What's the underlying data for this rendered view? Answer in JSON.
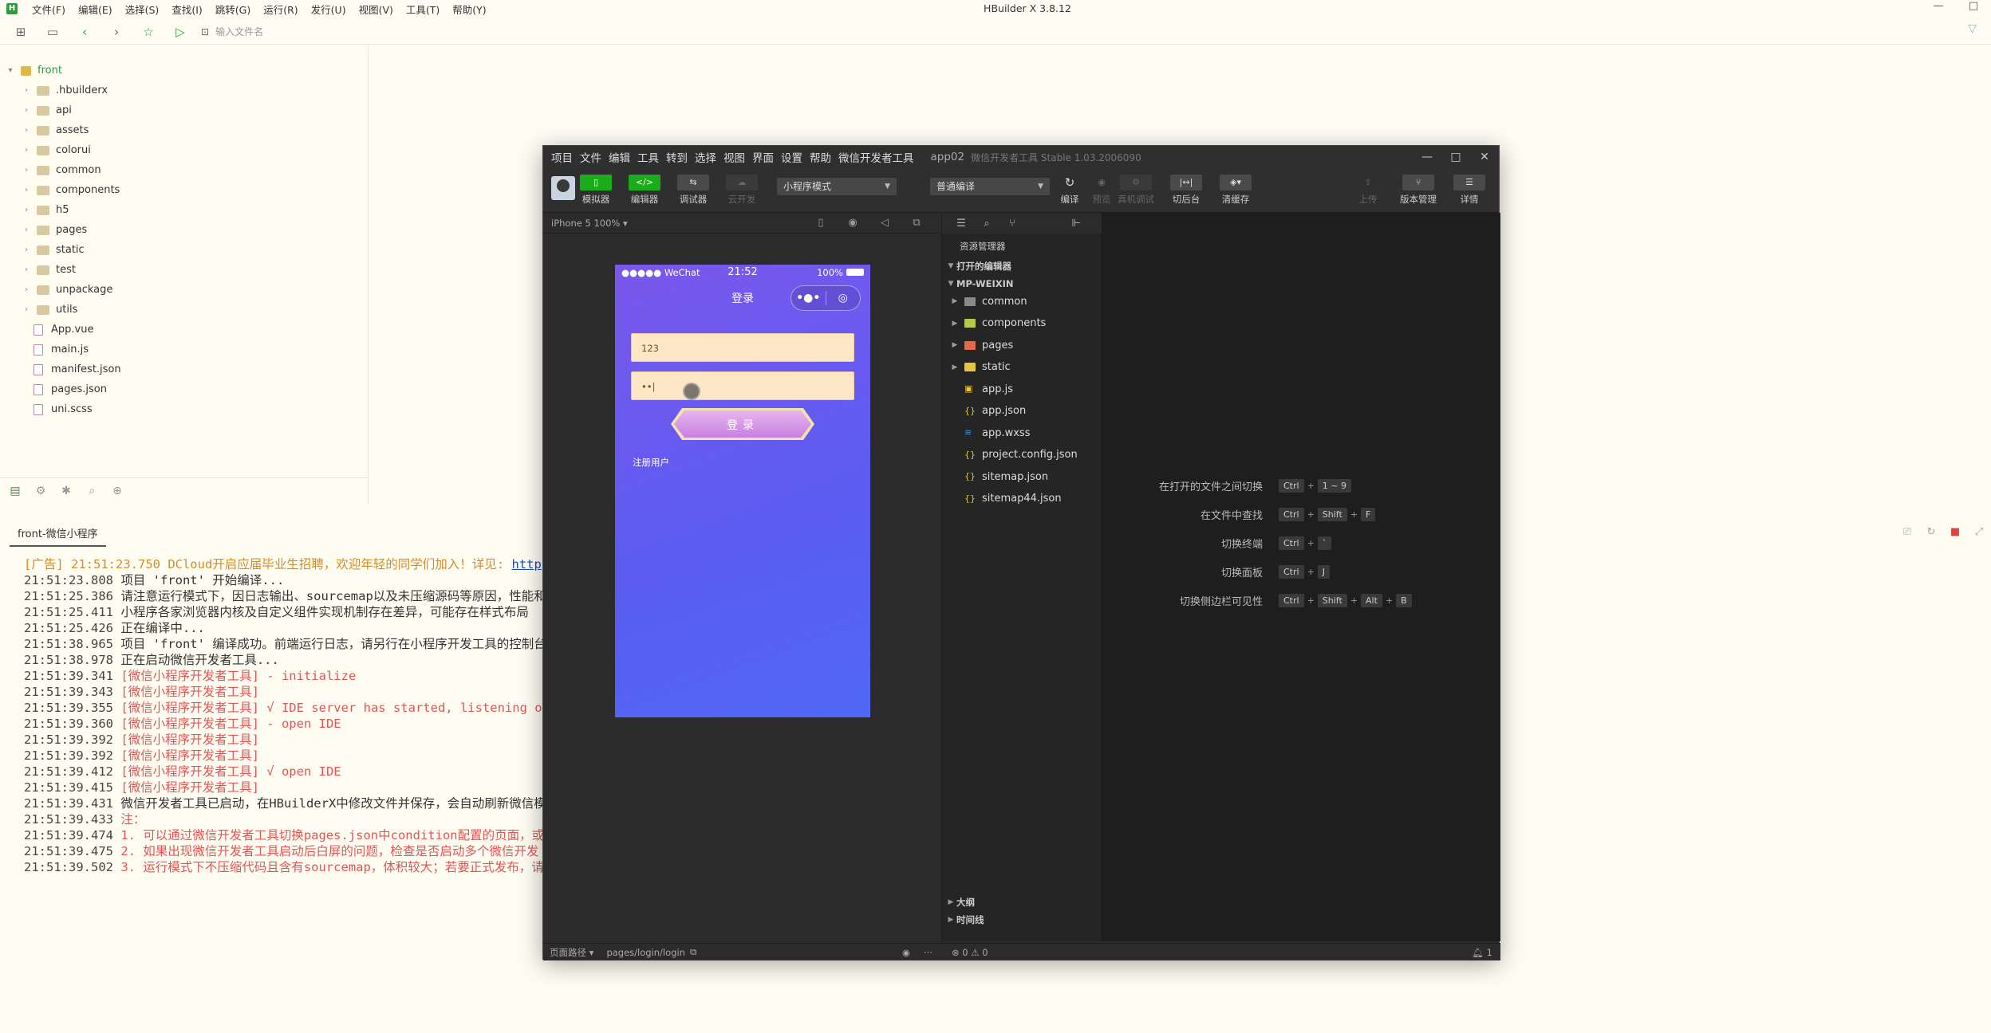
{
  "app": {
    "title": "HBuilder X 3.8.12",
    "menu": [
      "文件(F)",
      "编辑(E)",
      "选择(S)",
      "查找(I)",
      "跳转(G)",
      "运行(R)",
      "发行(U)",
      "视图(V)",
      "工具(T)",
      "帮助(Y)"
    ],
    "address_placeholder": "输入文件名"
  },
  "explorer": {
    "root": "front",
    "items": [
      {
        "name": ".hbuilderx",
        "type": "folder"
      },
      {
        "name": "api",
        "type": "folder"
      },
      {
        "name": "assets",
        "type": "folder"
      },
      {
        "name": "colorui",
        "type": "folder"
      },
      {
        "name": "common",
        "type": "folder"
      },
      {
        "name": "components",
        "type": "folder"
      },
      {
        "name": "h5",
        "type": "folder"
      },
      {
        "name": "pages",
        "type": "folder"
      },
      {
        "name": "static",
        "type": "folder"
      },
      {
        "name": "test",
        "type": "folder"
      },
      {
        "name": "unpackage",
        "type": "folder"
      },
      {
        "name": "utils",
        "type": "folder"
      },
      {
        "name": "App.vue",
        "type": "file"
      },
      {
        "name": "main.js",
        "type": "file"
      },
      {
        "name": "manifest.json",
        "type": "file"
      },
      {
        "name": "pages.json",
        "type": "file"
      },
      {
        "name": "uni.scss",
        "type": "file"
      }
    ]
  },
  "console": {
    "tab": "front-微信小程序",
    "lines": [
      {
        "ts": "[广告] 21:51:23.750",
        "text": " DCloud开启应届毕业生招聘，欢迎年轻的同学们加入！详见: ",
        "link": "http",
        "style": "ad"
      },
      {
        "ts": "21:51:23.808",
        "text": " 项目 'front' 开始编译...",
        "style": "normal"
      },
      {
        "ts": "21:51:25.386",
        "text": " 请注意运行模式下，因日志输出、sourcemap以及未压缩源码等原因，性能和",
        "style": "normal"
      },
      {
        "ts": "21:51:25.411",
        "text": " 小程序各家浏览器内核及自定义组件实现机制存在差异，可能存在样式布局",
        "style": "normal"
      },
      {
        "ts": "21:51:25.426",
        "text": " 正在编译中...",
        "style": "normal"
      },
      {
        "ts": "21:51:38.965",
        "text": " 项目 'front' 编译成功。前端运行日志，请另行在小程序开发工具的控制台",
        "style": "normal"
      },
      {
        "ts": "21:51:38.978",
        "text": " 正在启动微信开发者工具...",
        "style": "normal"
      },
      {
        "ts": "21:51:39.341",
        "text": " [微信小程序开发者工具] - initialize",
        "style": "red"
      },
      {
        "ts": "21:51:39.343",
        "text": " [微信小程序开发者工具]",
        "style": "red"
      },
      {
        "ts": "21:51:39.355",
        "text": " [微信小程序开发者工具] √ IDE server has started, listening on",
        "style": "red"
      },
      {
        "ts": "21:51:39.360",
        "text": " [微信小程序开发者工具] - open IDE",
        "style": "red"
      },
      {
        "ts": "21:51:39.392",
        "text": " [微信小程序开发者工具]",
        "style": "red"
      },
      {
        "ts": "21:51:39.392",
        "text": " [微信小程序开发者工具]",
        "style": "red"
      },
      {
        "ts": "21:51:39.412",
        "text": " [微信小程序开发者工具] √ open IDE",
        "style": "red"
      },
      {
        "ts": "21:51:39.415",
        "text": " [微信小程序开发者工具]",
        "style": "red"
      },
      {
        "ts": "21:51:39.431",
        "text": " 微信开发者工具已启动，在HBuilderX中修改文件并保存，会自动刷新微信模",
        "style": "normal"
      },
      {
        "ts": "21:51:39.433",
        "text": " 注：",
        "style": "red"
      },
      {
        "ts": "21:51:39.474",
        "text": " 1. 可以通过微信开发者工具切换pages.json中condition配置的页面，或",
        "style": "red"
      },
      {
        "ts": "21:51:39.475",
        "text": " 2. 如果出现微信开发者工具启动后白屏的问题，检查是否启动多个微信开发",
        "style": "red"
      },
      {
        "ts": "21:51:39.502",
        "text": " 3. 运行模式下不压缩代码且含有sourcemap，体积较大；若要正式发布，请",
        "style": "red"
      }
    ]
  },
  "wechat": {
    "menu": [
      "项目",
      "文件",
      "编辑",
      "工具",
      "转到",
      "选择",
      "视图",
      "界面",
      "设置",
      "帮助",
      "微信开发者工具"
    ],
    "app_name": "app02",
    "version": "微信开发者工具 Stable 1.03.2006090",
    "tools": {
      "simulator": "模拟器",
      "editor": "编辑器",
      "debugger": "调试器",
      "cloud": "云开发",
      "compile": "编译",
      "preview": "预览",
      "real_debug": "真机调试",
      "background": "切后台",
      "clear_cache": "清缓存",
      "upload": "上传",
      "version_mgmt": "版本管理",
      "details": "详情"
    },
    "mode_select": "小程序模式",
    "compile_select": "普通编译",
    "device": "iPhone 5 100% ▾",
    "footer_path_label": "页面路径 ▾",
    "footer_path": "pages/login/login",
    "footer_status": "⊗ 0 ⚠ 0",
    "footer_bell": "1"
  },
  "phone": {
    "carrier": "●●●●● WeChat",
    "time": "21:52",
    "battery": "100%",
    "nav_title": "登录",
    "username_value": "123",
    "password_value": "••|",
    "login_label": "登录",
    "register_label": "注册用户"
  },
  "resources": {
    "title": "资源管理器",
    "open_editors": "打开的编辑器",
    "project": "MP-WEIXIN",
    "items": [
      {
        "name": "common",
        "type": "folder"
      },
      {
        "name": "components",
        "type": "folder"
      },
      {
        "name": "pages",
        "type": "folder"
      },
      {
        "name": "static",
        "type": "folder"
      },
      {
        "name": "app.js",
        "type": "js"
      },
      {
        "name": "app.json",
        "type": "json"
      },
      {
        "name": "app.wxss",
        "type": "wxss"
      },
      {
        "name": "project.config.json",
        "type": "json"
      },
      {
        "name": "sitemap.json",
        "type": "json"
      },
      {
        "name": "sitemap44.json",
        "type": "json"
      }
    ],
    "outline": "大纲",
    "timeline": "时间线"
  },
  "shortcuts": [
    {
      "label": "在打开的文件之间切换",
      "keys": [
        "Ctrl",
        "1 ~ 9"
      ]
    },
    {
      "label": "在文件中查找",
      "keys": [
        "Ctrl",
        "Shift",
        "F"
      ]
    },
    {
      "label": "切换终端",
      "keys": [
        "Ctrl",
        "`"
      ]
    },
    {
      "label": "切换面板",
      "keys": [
        "Ctrl",
        "J"
      ]
    },
    {
      "label": "切换侧边栏可见性",
      "keys": [
        "Ctrl",
        "Shift",
        "Alt",
        "B"
      ]
    }
  ],
  "colors": {
    "accent_green": "#1aad19",
    "phone_gradient_top": "#7a58ec",
    "phone_gradient_bottom": "#5067f7",
    "console_red": "#e05555",
    "console_ad": "#d28c2c"
  }
}
